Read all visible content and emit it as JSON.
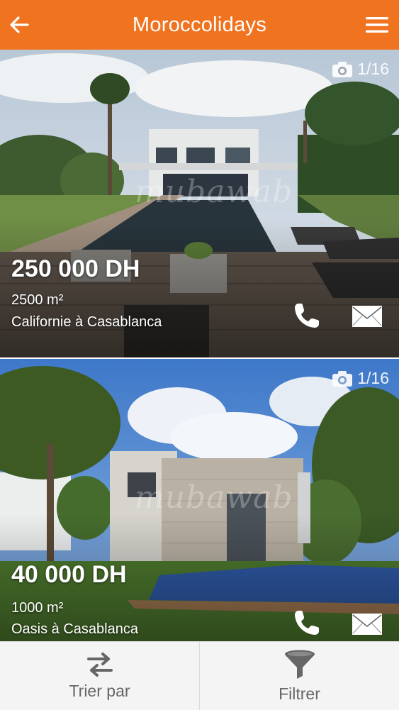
{
  "app_bar": {
    "title": "Moroccolidays",
    "back_icon": "arrow-left-icon",
    "menu_icon": "hamburger-menu-icon",
    "background_color": "#f07420"
  },
  "listings": [
    {
      "photo_counter": "1/16",
      "price": "250 000 DH",
      "area": "2500 m²",
      "location": "Californie à Casablanca",
      "watermark": "mubawab"
    },
    {
      "photo_counter": "1/16",
      "price": "40 000 DH",
      "area": "1000 m²",
      "location": "Oasis à Casablanca",
      "watermark": "mubawab"
    }
  ],
  "bottom_bar": {
    "sort_label": "Trier par",
    "sort_icon": "swap-arrows-icon",
    "filter_label": "Filtrer",
    "filter_icon": "funnel-icon"
  }
}
